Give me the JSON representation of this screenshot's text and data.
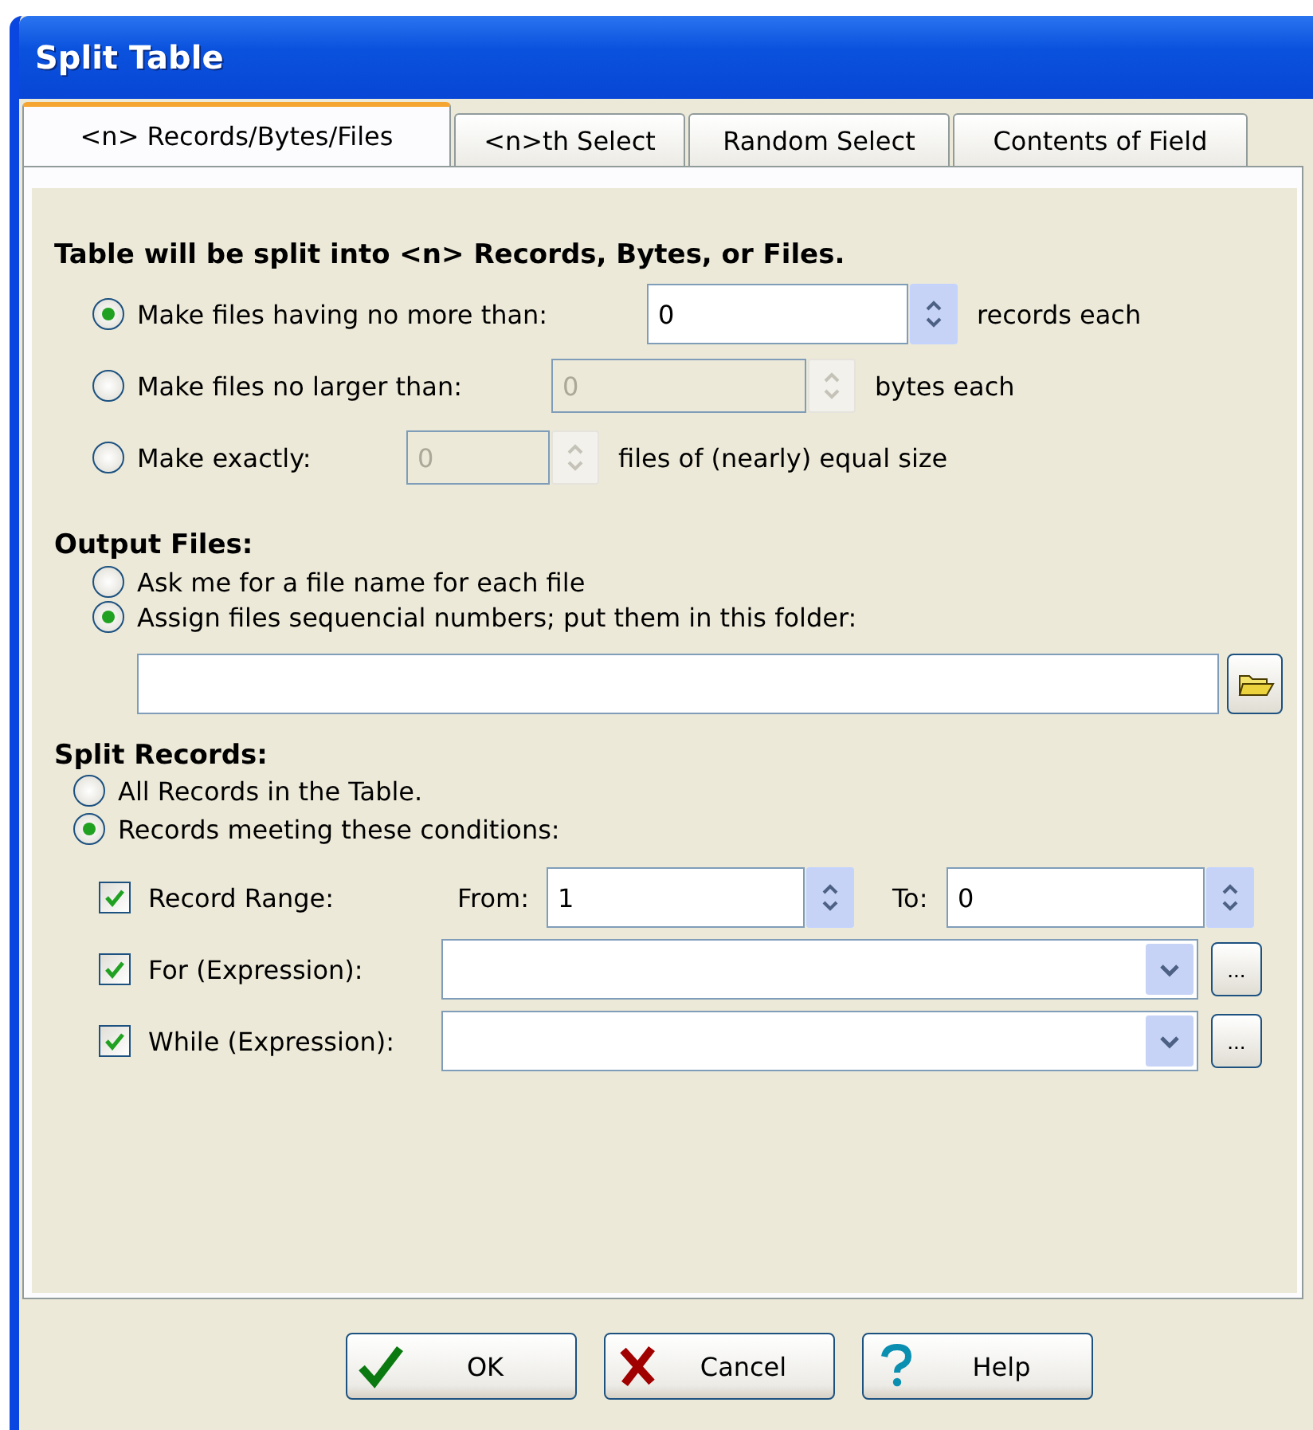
{
  "window": {
    "title": "Split Table"
  },
  "tabs": [
    {
      "label": "<n> Records/Bytes/Files",
      "selected": true
    },
    {
      "label": "<n>th Select",
      "selected": false
    },
    {
      "label": "Random Select",
      "selected": false
    },
    {
      "label": "Contents of Field",
      "selected": false
    }
  ],
  "records_section": {
    "heading": "Table will be split into <n> Records, Bytes, or Files.",
    "options": [
      {
        "label": "Make files having no more than:",
        "selected": true,
        "value": "0",
        "unit": "records each",
        "disabled": false
      },
      {
        "label": "Make files no larger than:",
        "selected": false,
        "value": "0",
        "unit": "bytes each",
        "disabled": true
      },
      {
        "label": "Make exactly:",
        "selected": false,
        "value": "0",
        "unit": "files of (nearly) equal size",
        "disabled": true
      }
    ]
  },
  "output_files": {
    "heading": "Output Files:",
    "options": [
      {
        "label": "Ask me for a file name for each file",
        "selected": false
      },
      {
        "label": "Assign files sequencial numbers; put them in this folder:",
        "selected": true
      }
    ],
    "folder_field": {
      "disabled": false
    }
  },
  "split_records": {
    "heading": "Split Records:",
    "options": [
      {
        "label": "All Records in the Table.",
        "selected": false
      },
      {
        "label": "Records meeting these conditions:",
        "selected": true
      }
    ],
    "conditions": [
      {
        "kind": "range",
        "label": "Record Range:",
        "checked": true,
        "from_label": "From:",
        "from_value": "1",
        "to_label": "To:",
        "to_value": "0"
      },
      {
        "kind": "expression",
        "label": "For (Expression):",
        "checked": true,
        "button_label": "..."
      },
      {
        "kind": "expression",
        "label": "While (Expression):",
        "checked": true,
        "button_label": "..."
      }
    ]
  },
  "buttons": [
    {
      "label": "OK",
      "kind": "ok"
    },
    {
      "label": "Cancel",
      "kind": "cancel"
    },
    {
      "label": "Help",
      "kind": "help"
    }
  ]
}
